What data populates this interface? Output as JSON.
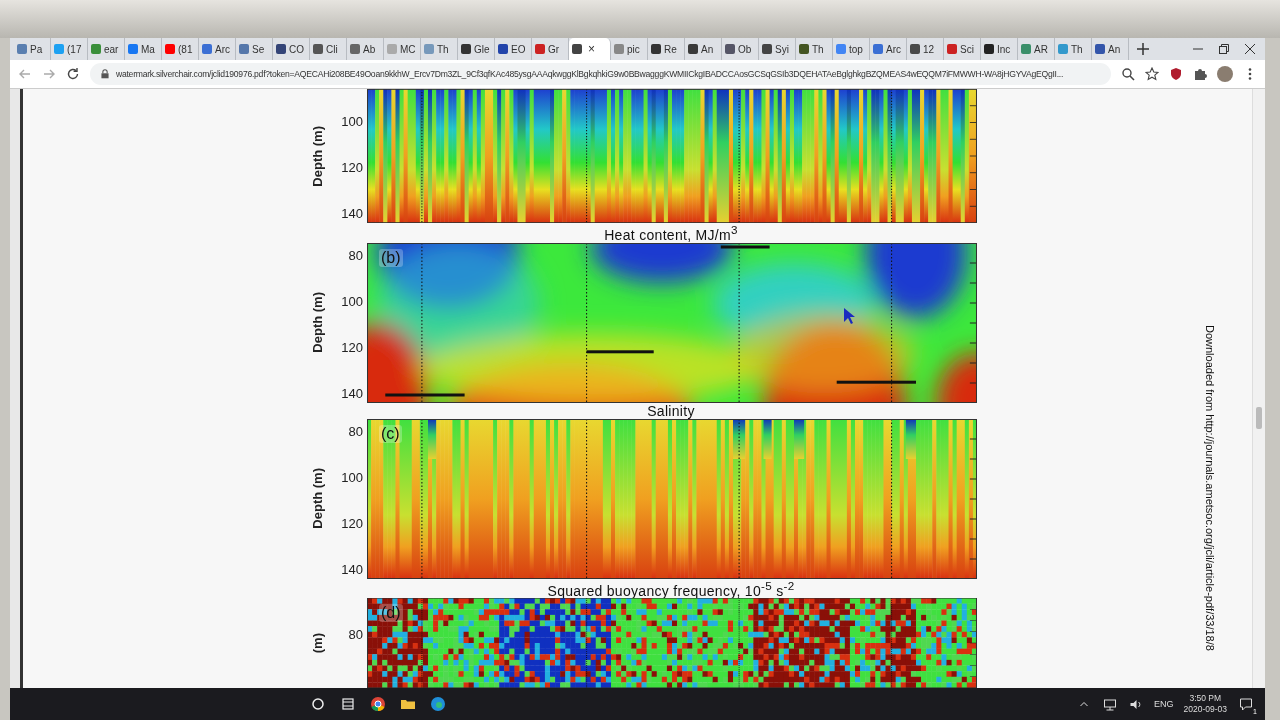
{
  "tabs": [
    {
      "label": "Pa",
      "color": "#5a7fb0",
      "selected": false
    },
    {
      "label": "(17",
      "color": "#1da1f2",
      "selected": false
    },
    {
      "label": "ear",
      "color": "#3a8f3a",
      "selected": false
    },
    {
      "label": "Ma",
      "color": "#1877f2",
      "selected": false
    },
    {
      "label": "(81",
      "color": "#ff0000",
      "selected": false
    },
    {
      "label": "Arc",
      "color": "#3b6fd4",
      "selected": false
    },
    {
      "label": "Se",
      "color": "#5577aa",
      "selected": false
    },
    {
      "label": "CO",
      "color": "#334477",
      "selected": false
    },
    {
      "label": "Cli",
      "color": "#555555",
      "selected": false
    },
    {
      "label": "Ab",
      "color": "#666666",
      "selected": false
    },
    {
      "label": "MC",
      "color": "#aaaaaa",
      "selected": false
    },
    {
      "label": "Th",
      "color": "#7799bb",
      "selected": false
    },
    {
      "label": "Gle",
      "color": "#333333",
      "selected": false
    },
    {
      "label": "EO",
      "color": "#2244aa",
      "selected": false
    },
    {
      "label": "Gr",
      "color": "#cc2222",
      "selected": false
    },
    {
      "close": "×",
      "color": "#444444",
      "selected": true
    },
    {
      "label": "pic",
      "color": "#888888",
      "selected": false
    },
    {
      "label": "Re",
      "color": "#333333",
      "selected": false
    },
    {
      "label": "An",
      "color": "#3a3a3a",
      "selected": false
    },
    {
      "label": "Ob",
      "color": "#555566",
      "selected": false
    },
    {
      "label": "Syi",
      "color": "#444444",
      "selected": false
    },
    {
      "label": "Th",
      "color": "#445522",
      "selected": false
    },
    {
      "label": "top",
      "color": "#4285f4",
      "selected": false
    },
    {
      "label": "Arc",
      "color": "#3b6fd4",
      "selected": false
    },
    {
      "label": "12",
      "color": "#4a4a4a",
      "selected": false
    },
    {
      "label": "Sci",
      "color": "#cc2222",
      "selected": false
    },
    {
      "label": "Inc",
      "color": "#222222",
      "selected": false
    },
    {
      "label": "AR",
      "color": "#3a8f6a",
      "selected": false
    },
    {
      "label": "Th",
      "color": "#3399cc",
      "selected": false
    },
    {
      "label": "An",
      "color": "#3355aa",
      "selected": false
    }
  ],
  "address_bar": {
    "url": "watermark.silverchair.com/jclid190976.pdf?token=AQECAHi208BE49Ooan9kkhW_Ercv7Dm3ZL_9Cf3qfKAc485ysgAAAqkwggKlBgkqhkiG9w0BBwagggKWMIICkgIBADCCAosGCSqGSIb3DQEHATAeBglghkgBZQMEAS4wEQQM7iFMWWH-WA8jHGYVAgEQgII..."
  },
  "document": {
    "panels": [
      {
        "kind": "streaky",
        "ylabel": "Depth (m)",
        "ticks": [
          "100",
          "120",
          "140"
        ]
      },
      {
        "title": "Heat content, MJ/m$^{3}$",
        "kind": "smooth",
        "label": "(b)",
        "ylabel": "Depth (m)",
        "ticks": [
          "80",
          "100",
          "120",
          "140"
        ]
      },
      {
        "title": "Salinity",
        "kind": "warm",
        "label": "(c)",
        "ylabel": "Depth (m)",
        "ticks": [
          "80",
          "100",
          "120",
          "140"
        ]
      },
      {
        "title": "Squared buoyancy frequency, 10$^{-5}$ s$^{-2}$",
        "kind": "noisy",
        "label": "(d)",
        "ylabel": "(m)",
        "ticks": [
          "80"
        ]
      }
    ],
    "side_note": "Downloaded from http://journals.ametsoc.org/jcli/article-pdf/33/18/8"
  },
  "taskbar": {
    "language": "ENG",
    "time": "3:50 PM",
    "date": "2020-09-03",
    "notifications": "1"
  }
}
